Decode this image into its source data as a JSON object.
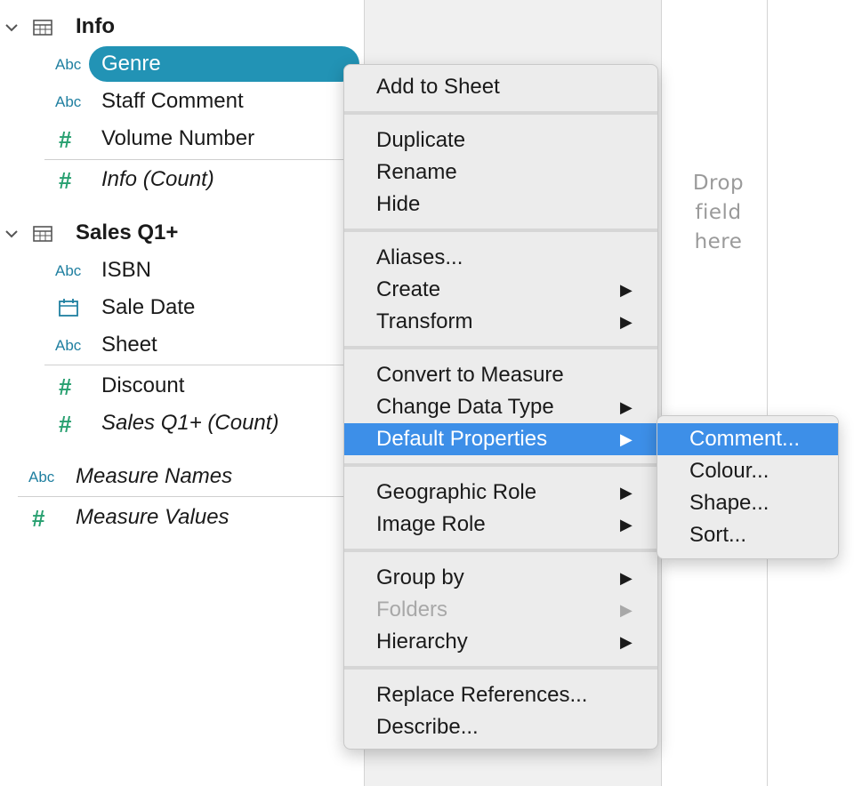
{
  "data_pane": {
    "tables": [
      {
        "name": "Info",
        "fields": [
          {
            "type": "Abc",
            "name": "Genre",
            "selected": true
          },
          {
            "type": "Abc",
            "name": "Staff Comment"
          },
          {
            "type": "#",
            "name": "Volume Number"
          },
          {
            "type": "#",
            "name": "Info (Count)",
            "italic": true
          }
        ]
      },
      {
        "name": "Sales Q1+",
        "fields": [
          {
            "type": "Abc",
            "name": "ISBN"
          },
          {
            "type": "calendar-icon",
            "name": "Sale Date"
          },
          {
            "type": "Abc",
            "name": "Sheet"
          },
          {
            "type": "#",
            "name": "Discount"
          },
          {
            "type": "#",
            "name": "Sales Q1+ (Count)",
            "italic": true
          }
        ]
      }
    ],
    "measure_names": {
      "type": "Abc",
      "name": "Measure Names"
    },
    "measure_values": {
      "type": "#",
      "name": "Measure Values"
    }
  },
  "drop_hint": [
    "Drop",
    "field",
    "here"
  ],
  "context_menu": {
    "groups": [
      [
        {
          "label": "Add to Sheet"
        }
      ],
      [
        {
          "label": "Duplicate"
        },
        {
          "label": "Rename"
        },
        {
          "label": "Hide"
        }
      ],
      [
        {
          "label": "Aliases..."
        },
        {
          "label": "Create",
          "submenu": true
        },
        {
          "label": "Transform",
          "submenu": true
        }
      ],
      [
        {
          "label": "Convert to Measure"
        },
        {
          "label": "Change Data Type",
          "submenu": true
        },
        {
          "label": "Default Properties",
          "submenu": true,
          "highlighted": true
        }
      ],
      [
        {
          "label": "Geographic Role",
          "submenu": true
        },
        {
          "label": "Image Role",
          "submenu": true
        }
      ],
      [
        {
          "label": "Group by",
          "submenu": true
        },
        {
          "label": "Folders",
          "submenu": true,
          "disabled": true
        },
        {
          "label": "Hierarchy",
          "submenu": true
        }
      ],
      [
        {
          "label": "Replace References..."
        },
        {
          "label": "Describe..."
        }
      ]
    ],
    "arrow_glyph": "▶"
  },
  "submenu": {
    "items": [
      {
        "label": "Comment...",
        "highlighted": true
      },
      {
        "label": "Colour..."
      },
      {
        "label": "Shape..."
      },
      {
        "label": "Sort..."
      }
    ]
  },
  "colors": {
    "accent_pill": "#2293b5",
    "menu_highlight": "#3d8fe8",
    "dimension_type": "#1f7fa0",
    "measure_type": "#28a070"
  }
}
